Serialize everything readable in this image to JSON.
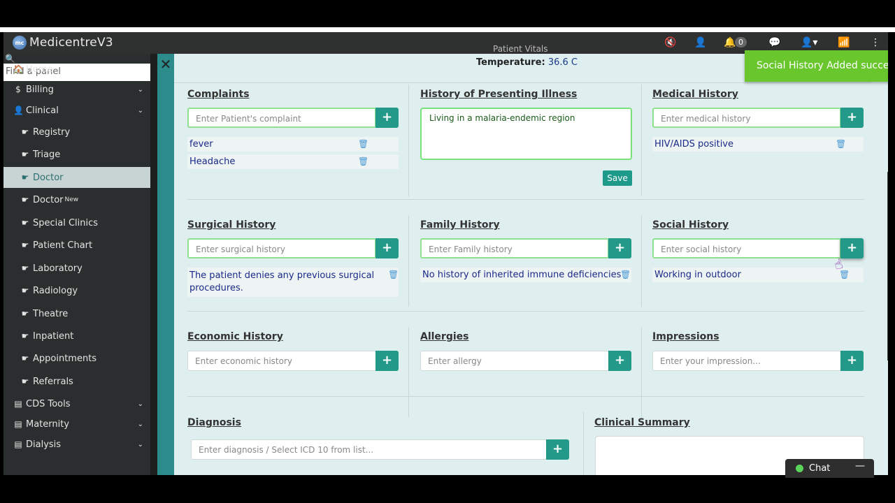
{
  "app": {
    "title": "MedicentreV3",
    "logo_text": "mc"
  },
  "navbar": {
    "notification_count": "0"
  },
  "toast": {
    "message": "Social History Added succes"
  },
  "sidebar": {
    "search_placeholder": "Find a panel",
    "items": [
      {
        "label": "Home",
        "icon": "home-icon",
        "glyph": "🏠"
      },
      {
        "label": "Billing",
        "icon": "dollar-icon",
        "glyph": "$"
      },
      {
        "label": "Clinical",
        "icon": "user-icon",
        "glyph": "👤"
      },
      {
        "label": "Registry",
        "icon": "hand-point-icon",
        "glyph": "☛"
      },
      {
        "label": "Triage",
        "icon": "hand-point-icon",
        "glyph": "☛"
      },
      {
        "label": "Doctor",
        "icon": "hand-point-icon",
        "glyph": "☛"
      },
      {
        "label": "Doctor",
        "icon": "hand-point-icon",
        "glyph": "☛",
        "badge": "New"
      },
      {
        "label": "Special Clinics",
        "icon": "hand-point-icon",
        "glyph": "☛"
      },
      {
        "label": "Patient Chart",
        "icon": "hand-point-icon",
        "glyph": "☛"
      },
      {
        "label": "Laboratory",
        "icon": "hand-point-icon",
        "glyph": "☛"
      },
      {
        "label": "Radiology",
        "icon": "hand-point-icon",
        "glyph": "☛"
      },
      {
        "label": "Theatre",
        "icon": "hand-point-icon",
        "glyph": "☛"
      },
      {
        "label": "Inpatient",
        "icon": "hand-point-icon",
        "glyph": "☛"
      },
      {
        "label": "Appointments",
        "icon": "hand-point-icon",
        "glyph": "☛"
      },
      {
        "label": "Referrals",
        "icon": "hand-point-icon",
        "glyph": "☛"
      },
      {
        "label": "CDS Tools",
        "icon": "book-icon",
        "glyph": "▤"
      },
      {
        "label": "Maternity",
        "icon": "book-icon",
        "glyph": "▤"
      },
      {
        "label": "Dialysis",
        "icon": "book-icon",
        "glyph": "▤"
      }
    ]
  },
  "vitals": {
    "ghost_text": "Patient Vitals",
    "temperature_label": "Temperature:",
    "temperature_value": "36.6 C"
  },
  "sections": {
    "complaints": {
      "title": "Complaints",
      "placeholder": "Enter Patient's complaint",
      "items": [
        "fever",
        "Headache"
      ]
    },
    "hpi": {
      "title": "History of Presenting Illness",
      "value": "Living in a malaria-endemic region",
      "save_label": "Save"
    },
    "medical": {
      "title": "Medical History",
      "placeholder": "Enter medical history",
      "items": [
        "HIV/AIDS positive"
      ]
    },
    "surgical": {
      "title": "Surgical History",
      "placeholder": "Enter surgical history",
      "items": [
        "The patient denies any previous surgical procedures."
      ]
    },
    "family": {
      "title": "Family History",
      "placeholder": "Enter Family history",
      "items": [
        "No history of inherited immune deficiencies"
      ]
    },
    "social": {
      "title": "Social History",
      "placeholder": "Enter social history",
      "items": [
        "Working in outdoor"
      ]
    },
    "economic": {
      "title": "Economic History",
      "placeholder": "Enter economic history"
    },
    "allergies": {
      "title": "Allergies",
      "placeholder": "Enter allergy"
    },
    "impressions": {
      "title": "Impressions",
      "placeholder": "Enter your impression..."
    },
    "diagnosis": {
      "title": "Diagnosis",
      "placeholder": "Enter diagnosis / Select ICD 10 from list..."
    },
    "summary": {
      "title": "Clinical Summary"
    }
  },
  "buttons": {
    "add_glyph": "+"
  },
  "chat": {
    "label": "Chat"
  }
}
